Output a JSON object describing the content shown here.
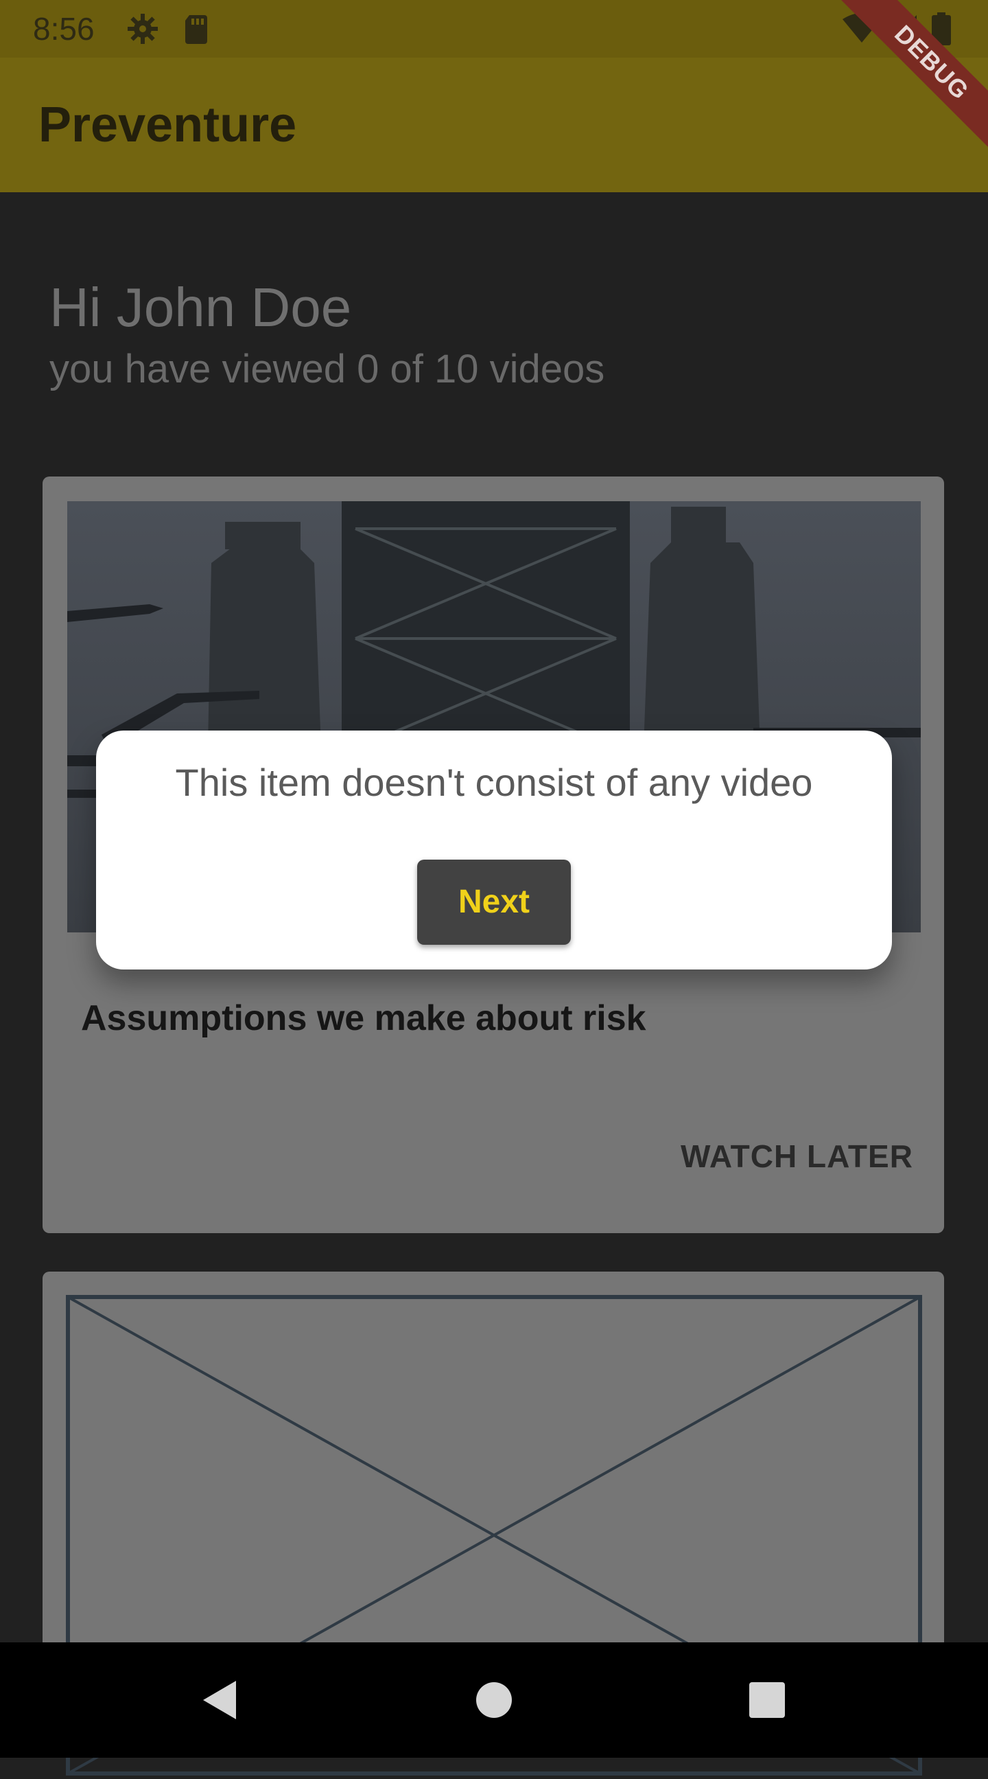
{
  "status_bar": {
    "time": "8:56",
    "icons": [
      "settings-icon",
      "sd-card-icon",
      "wifi-icon",
      "signal-icon",
      "battery-icon"
    ]
  },
  "debug_banner": "DEBUG",
  "app_bar": {
    "title": "Preventure"
  },
  "header": {
    "greeting": "Hi John Doe",
    "progress_text": "you have viewed 0 of 10 videos"
  },
  "cards": [
    {
      "title": "Assumptions we make about risk",
      "action_label": "WATCH LATER",
      "image": "bridge-photo"
    },
    {
      "image": "placeholder-image"
    }
  ],
  "dialog": {
    "message": "This item doesn't consist of any video",
    "button_label": "Next"
  },
  "nav_bar": {
    "icons": [
      "back-icon",
      "home-icon",
      "recents-icon"
    ]
  },
  "colors": {
    "accent_yellow": "#f0d11a",
    "app_bar_dimmed": "#736510",
    "background": "#212121"
  }
}
